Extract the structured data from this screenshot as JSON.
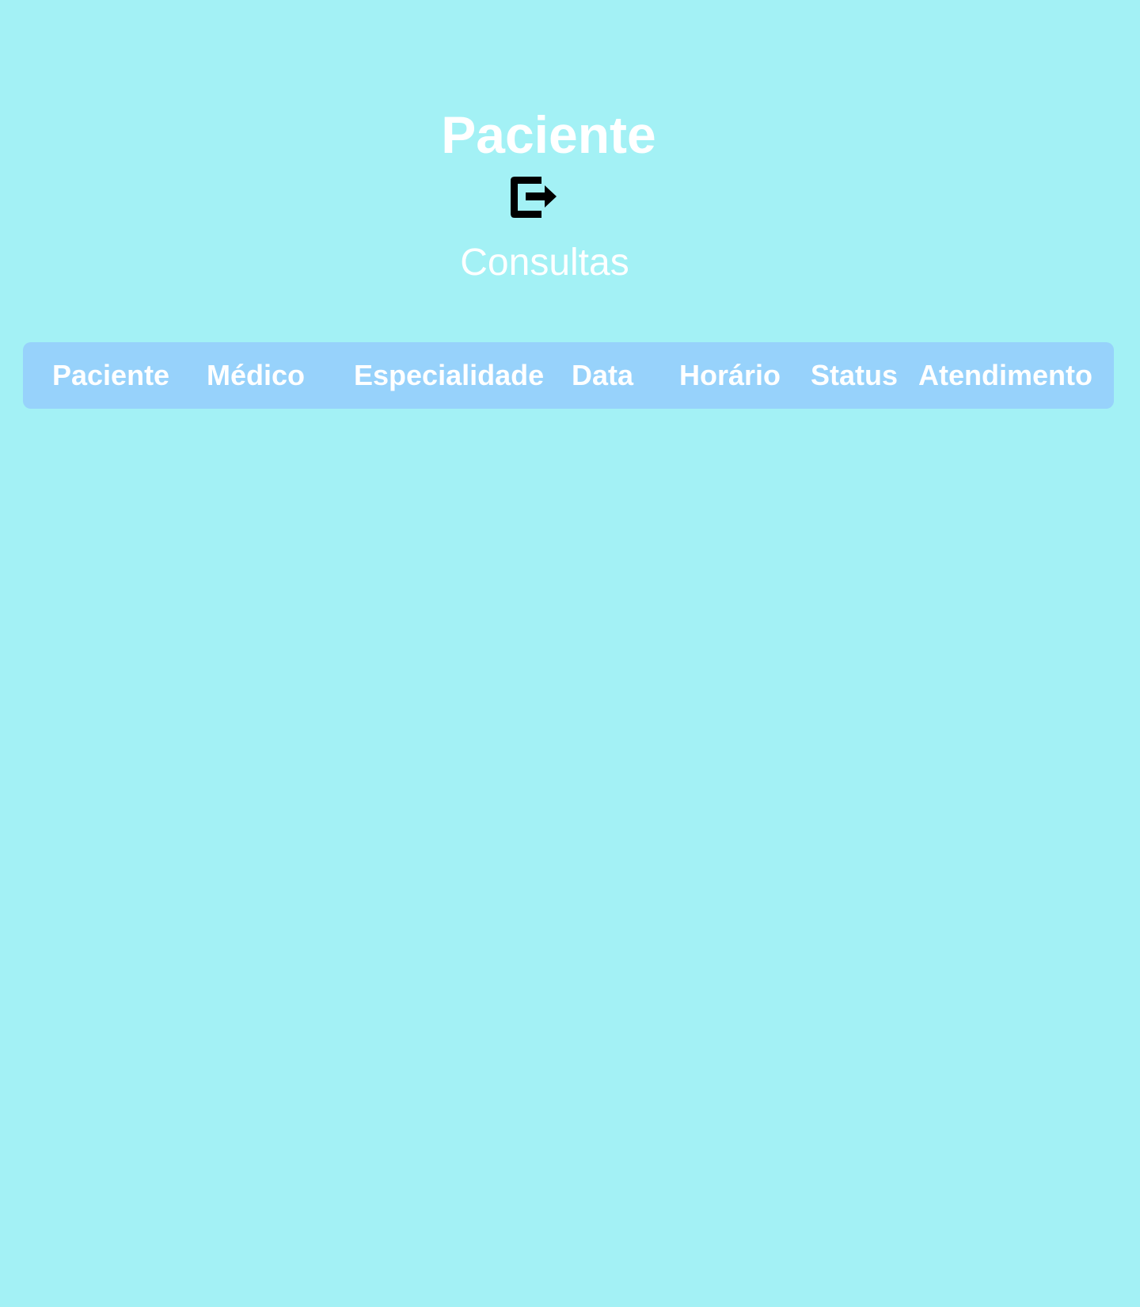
{
  "header": {
    "title": "Paciente",
    "logout_icon": "logout-icon",
    "subtitle": "Consultas"
  },
  "table": {
    "columns": [
      "Paciente",
      "Médico",
      "Especialidade",
      "Data",
      "Horário",
      "Status",
      "Atendimento"
    ],
    "rows": []
  },
  "colors": {
    "background": "#a3f1f5",
    "table_header": "#97d2fb",
    "text": "#ffffff",
    "icon": "#000000"
  }
}
